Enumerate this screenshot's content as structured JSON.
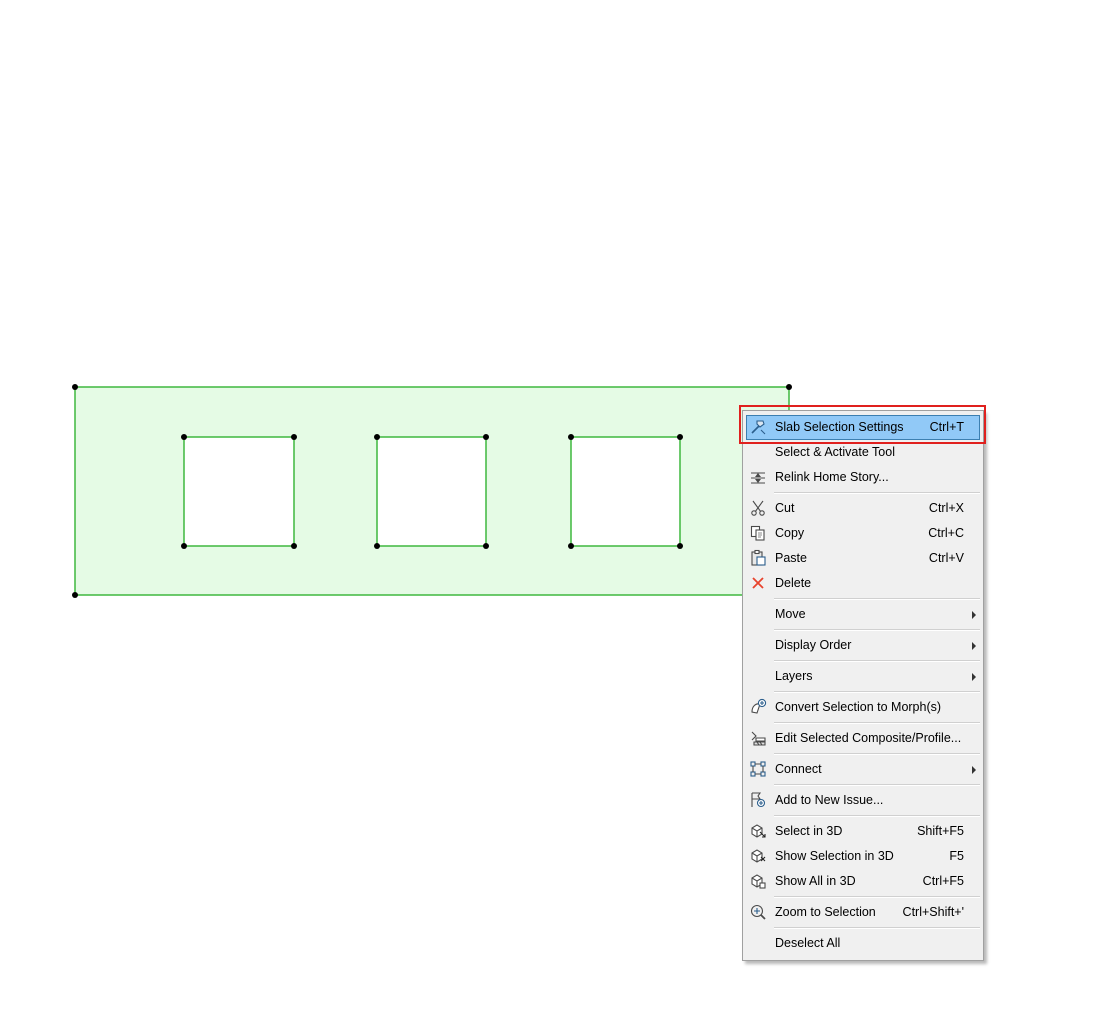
{
  "colors": {
    "slab_fill": "#e5fbe5",
    "slab_stroke": "#3fb83f",
    "node": "#000000",
    "menu_bg": "#f0f0f0",
    "highlight_bg": "#91c9f7",
    "highlight_border": "#3c7fb1",
    "callout_frame": "#e0201e",
    "delete_icon": "#e8432d"
  },
  "menu": {
    "items": [
      {
        "id": "slab-selection-settings",
        "icon": "hammer-icon",
        "label": "Slab Selection Settings",
        "shortcut": "Ctrl+T",
        "highlighted": true
      },
      {
        "id": "select-activate-tool",
        "icon": "",
        "label": "Select & Activate Tool",
        "shortcut": ""
      },
      {
        "id": "relink-home-story",
        "icon": "story-icon",
        "label": "Relink Home Story...",
        "shortcut": "",
        "sep_after": true
      },
      {
        "id": "cut",
        "icon": "scissors-icon",
        "label": "Cut",
        "shortcut": "Ctrl+X"
      },
      {
        "id": "copy",
        "icon": "copy-icon",
        "label": "Copy",
        "shortcut": "Ctrl+C"
      },
      {
        "id": "paste",
        "icon": "paste-icon",
        "label": "Paste",
        "shortcut": "Ctrl+V"
      },
      {
        "id": "delete",
        "icon": "delete-icon",
        "label": "Delete",
        "shortcut": "",
        "sep_after": true
      },
      {
        "id": "move",
        "icon": "",
        "label": "Move",
        "shortcut": "",
        "submenu": true,
        "sep_after": true
      },
      {
        "id": "display-order",
        "icon": "",
        "label": "Display Order",
        "shortcut": "",
        "submenu": true,
        "sep_after": true
      },
      {
        "id": "layers",
        "icon": "",
        "label": "Layers",
        "shortcut": "",
        "submenu": true,
        "sep_after": true
      },
      {
        "id": "convert-to-morph",
        "icon": "morph-icon",
        "label": "Convert Selection to Morph(s)",
        "shortcut": "",
        "sep_after": true
      },
      {
        "id": "edit-composite-profile",
        "icon": "composite-icon",
        "label": "Edit Selected Composite/Profile...",
        "shortcut": "",
        "sep_after": true
      },
      {
        "id": "connect",
        "icon": "connect-icon",
        "label": "Connect",
        "shortcut": "",
        "submenu": true,
        "sep_after": true
      },
      {
        "id": "add-to-new-issue",
        "icon": "issue-icon",
        "label": "Add to New Issue...",
        "shortcut": "",
        "sep_after": true
      },
      {
        "id": "select-in-3d",
        "icon": "select-3d-icon",
        "label": "Select in 3D",
        "shortcut": "Shift+F5"
      },
      {
        "id": "show-selection-in-3d",
        "icon": "show-selection-3d-icon",
        "label": "Show Selection in 3D",
        "shortcut": "F5"
      },
      {
        "id": "show-all-in-3d",
        "icon": "show-all-3d-icon",
        "label": "Show All in 3D",
        "shortcut": "Ctrl+F5",
        "sep_after": true
      },
      {
        "id": "zoom-to-selection",
        "icon": "zoom-icon",
        "label": "Zoom to Selection",
        "shortcut": "Ctrl+Shift+'",
        "sep_after": true
      },
      {
        "id": "deselect-all",
        "icon": "",
        "label": "Deselect All",
        "shortcut": ""
      }
    ]
  }
}
